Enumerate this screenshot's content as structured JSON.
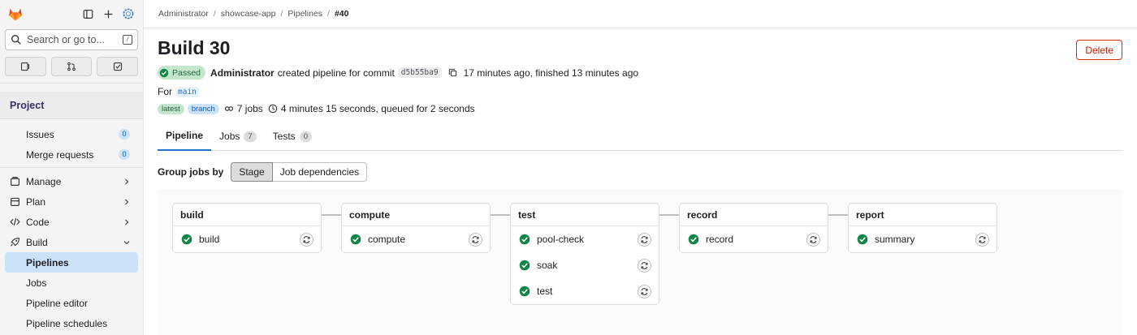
{
  "sidebar": {
    "search_placeholder": "Search or go to...",
    "kbd": "/",
    "section": "Project",
    "items": [
      {
        "label": "Issues",
        "count": "0"
      },
      {
        "label": "Merge requests",
        "count": "0"
      }
    ],
    "groups": [
      {
        "label": "Manage"
      },
      {
        "label": "Plan"
      },
      {
        "label": "Code"
      },
      {
        "label": "Build"
      }
    ],
    "build_items": [
      "Pipelines",
      "Jobs",
      "Pipeline editor",
      "Pipeline schedules"
    ]
  },
  "breadcrumbs": [
    "Administrator",
    "showcase-app",
    "Pipelines",
    "#40"
  ],
  "page": {
    "title": "Build 30",
    "delete_label": "Delete",
    "status": "Passed",
    "author": "Administrator",
    "created_text": "created pipeline for commit",
    "sha": "d5b55ba9",
    "timing": "17 minutes ago, finished 13 minutes ago",
    "for_label": "For",
    "ref": "main",
    "tag_latest": "latest",
    "tag_branch": "branch",
    "jobs_count": "7 jobs",
    "duration": "4 minutes 15 seconds, queued for 2 seconds"
  },
  "tabs": [
    {
      "label": "Pipeline",
      "count": null
    },
    {
      "label": "Jobs",
      "count": "7"
    },
    {
      "label": "Tests",
      "count": "0"
    }
  ],
  "group_by": {
    "label": "Group jobs by",
    "options": [
      "Stage",
      "Job dependencies"
    ]
  },
  "stages": [
    {
      "name": "build",
      "jobs": [
        "build"
      ]
    },
    {
      "name": "compute",
      "jobs": [
        "compute"
      ]
    },
    {
      "name": "test",
      "jobs": [
        "pool-check",
        "soak",
        "test"
      ]
    },
    {
      "name": "record",
      "jobs": [
        "record"
      ]
    },
    {
      "name": "report",
      "jobs": [
        "summary"
      ]
    }
  ],
  "colors": {
    "accent": "#1f75cb",
    "success": "#108548",
    "danger": "#dd2b0e",
    "brand": "#e24329"
  }
}
